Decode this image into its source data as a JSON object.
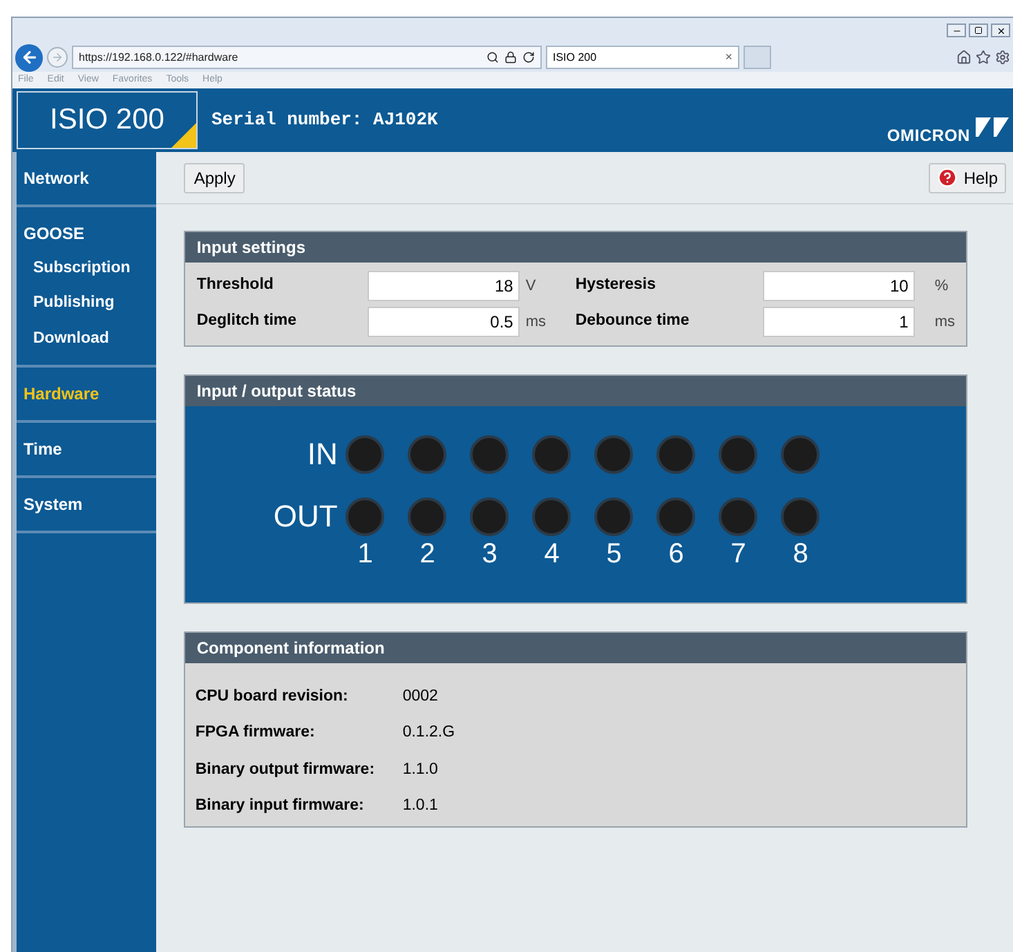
{
  "browser": {
    "address": "https://192.168.0.122/#hardware",
    "tab": {
      "title": "ISIO 200",
      "close": "×"
    },
    "menu": [
      "File",
      "Edit",
      "View",
      "Favorites",
      "Tools",
      "Help"
    ]
  },
  "header": {
    "product": "ISIO 200",
    "serial": "Serial number: AJ102K",
    "brand": "OMICRON"
  },
  "sidebar": {
    "items": [
      {
        "label": "Network",
        "selected": false
      },
      {
        "label": "GOOSE",
        "selected": false,
        "children": [
          {
            "label": "Subscription",
            "selected": false
          },
          {
            "label": "Publishing",
            "selected": false
          },
          {
            "label": "Download",
            "selected": false
          }
        ]
      },
      {
        "label": "Hardware",
        "selected": true
      },
      {
        "label": "Time",
        "selected": false
      },
      {
        "label": "System",
        "selected": false
      }
    ]
  },
  "toolbar": {
    "apply": "Apply",
    "help": "Help"
  },
  "input_settings": {
    "title": "Input settings",
    "fields": [
      {
        "label": "Threshold",
        "value": "18",
        "unit": "V"
      },
      {
        "label": "Hysteresis",
        "value": "10",
        "unit": "%"
      },
      {
        "label": "Deglitch time",
        "value": "0.5",
        "unit": "ms"
      },
      {
        "label": "Debounce time",
        "value": "1",
        "unit": "ms"
      }
    ]
  },
  "io_status": {
    "title": "Input / output status",
    "rows": [
      {
        "label": "IN",
        "leds": [
          {
            "on": false
          },
          {
            "on": false
          },
          {
            "on": false
          },
          {
            "on": false
          },
          {
            "on": false
          },
          {
            "on": false
          },
          {
            "on": false
          },
          {
            "on": false
          }
        ]
      },
      {
        "label": "OUT",
        "leds": [
          {
            "on": false
          },
          {
            "on": false
          },
          {
            "on": false
          },
          {
            "on": false
          },
          {
            "on": false
          },
          {
            "on": false
          },
          {
            "on": false
          },
          {
            "on": false
          }
        ]
      }
    ],
    "numbers": [
      "1",
      "2",
      "3",
      "4",
      "5",
      "6",
      "7",
      "8"
    ]
  },
  "component_info": {
    "title": "Component information",
    "rows": [
      {
        "label": "CPU board revision:",
        "value": "0002"
      },
      {
        "label": "FPGA firmware:",
        "value": "0.1.2.G"
      },
      {
        "label": "Binary output firmware:",
        "value": "1.1.0"
      },
      {
        "label": "Binary input firmware:",
        "value": "1.0.1"
      }
    ]
  }
}
